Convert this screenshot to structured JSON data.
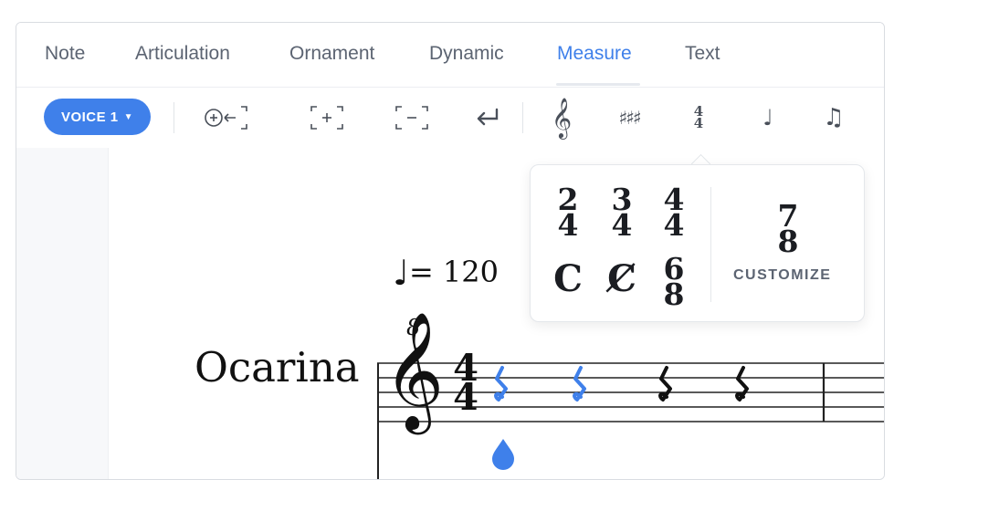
{
  "tabs": [
    {
      "label": "Note",
      "active": false
    },
    {
      "label": "Articulation",
      "active": false
    },
    {
      "label": "Ornament",
      "active": false
    },
    {
      "label": "Dynamic",
      "active": false
    },
    {
      "label": "Measure",
      "active": true
    },
    {
      "label": "Text",
      "active": false
    }
  ],
  "toolbar": {
    "voice_label": "VOICE 1",
    "tools": [
      "insert-measure-before-icon",
      "add-measure-icon",
      "remove-measure-icon",
      "line-break-icon",
      "clef-icon",
      "key-signature-icon",
      "time-signature-icon",
      "pickup-measure-icon",
      "tuplet-icon"
    ]
  },
  "score": {
    "tempo_value": "= 120",
    "instrument_name": "Ocarina",
    "clef_octave": "8",
    "time_signature": {
      "top": "4",
      "bottom": "4"
    }
  },
  "time_signature_popover": {
    "options": [
      {
        "top": "2",
        "bottom": "4"
      },
      {
        "top": "3",
        "bottom": "4"
      },
      {
        "top": "4",
        "bottom": "4"
      },
      {
        "symbol": "C"
      },
      {
        "symbol": "C̸"
      },
      {
        "top": "6",
        "bottom": "8"
      }
    ],
    "custom_example": {
      "top": "7",
      "bottom": "8"
    },
    "customize_label": "CUSTOMIZE"
  },
  "colors": {
    "accent": "#3f80ea",
    "text": "#5c6472"
  }
}
